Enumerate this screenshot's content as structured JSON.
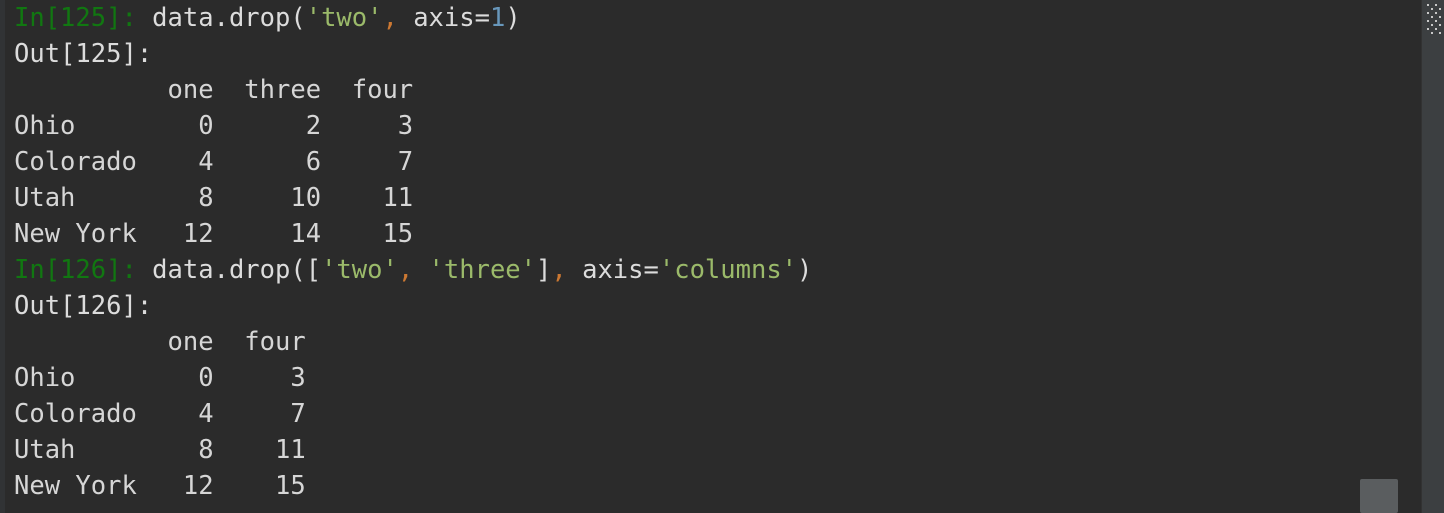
{
  "theme": {
    "background": "#2b2b2b",
    "gutter": "#313335",
    "text": "#dcdcdc",
    "prompt_green": "#117711",
    "string_green": "#9bba6a",
    "number_blue": "#6897bb",
    "comma_orange": "#cc7832",
    "scrollbar_track": "#3c3f41",
    "scrollbar_thumb": "#5a5d5f"
  },
  "console": {
    "title": "IPython console",
    "lines": [
      {
        "id": "in-125",
        "kind": "input",
        "prompt": "In[125]:",
        "code_plain": " data.drop(",
        "text": "In[125]: data.drop('two', axis=1)"
      },
      {
        "id": "out-125-label",
        "kind": "output-label",
        "text": "Out[125]:"
      },
      {
        "id": "out-125-header",
        "kind": "output",
        "text": "          one  three  four"
      },
      {
        "id": "out-125-row-ohio",
        "kind": "output",
        "text": "Ohio        0      2     3"
      },
      {
        "id": "out-125-row-colorado",
        "kind": "output",
        "text": "Colorado    4      6     7"
      },
      {
        "id": "out-125-row-utah",
        "kind": "output",
        "text": "Utah        8     10    11"
      },
      {
        "id": "out-125-row-newyork",
        "kind": "output",
        "text": "New York   12     14    15"
      },
      {
        "id": "in-126",
        "kind": "input",
        "prompt": "In[126]:",
        "text": "In[126]: data.drop(['two', 'three'], axis='columns')"
      },
      {
        "id": "out-126-label",
        "kind": "output-label",
        "text": "Out[126]:"
      },
      {
        "id": "out-126-header",
        "kind": "output",
        "text": "          one  four"
      },
      {
        "id": "out-126-row-ohio",
        "kind": "output",
        "text": "Ohio        0     3"
      },
      {
        "id": "out-126-row-colorado",
        "kind": "output",
        "text": "Colorado    4     7"
      },
      {
        "id": "out-126-row-utah",
        "kind": "output",
        "text": "Utah        8    11"
      },
      {
        "id": "out-126-row-newyork",
        "kind": "output",
        "text": "New York   12    15"
      }
    ]
  },
  "cell_125": {
    "prompt_in": "In[125]:",
    "prompt_out": "Out[125]:",
    "code_tokens": [
      {
        "t": "plain",
        "v": " data.drop("
      },
      {
        "t": "string",
        "v": "'two'"
      },
      {
        "t": "comma",
        "v": ","
      },
      {
        "t": "plain",
        "v": " axis="
      },
      {
        "t": "number",
        "v": "1"
      },
      {
        "t": "plain",
        "v": ")"
      }
    ],
    "table": {
      "index_name": "",
      "columns": [
        "one",
        "three",
        "four"
      ],
      "index": [
        "Ohio",
        "Colorado",
        "Utah",
        "New York"
      ],
      "rows": [
        [
          "0",
          "2",
          "3"
        ],
        [
          "4",
          "6",
          "7"
        ],
        [
          "8",
          "10",
          "11"
        ],
        [
          "12",
          "14",
          "15"
        ]
      ]
    }
  },
  "cell_126": {
    "prompt_in": "In[126]:",
    "prompt_out": "Out[126]:",
    "code_tokens": [
      {
        "t": "plain",
        "v": " data.drop(["
      },
      {
        "t": "string",
        "v": "'two'"
      },
      {
        "t": "comma",
        "v": ","
      },
      {
        "t": "plain",
        "v": " "
      },
      {
        "t": "string",
        "v": "'three'"
      },
      {
        "t": "plain",
        "v": "]"
      },
      {
        "t": "comma",
        "v": ","
      },
      {
        "t": "plain",
        "v": " axis="
      },
      {
        "t": "string",
        "v": "'columns'"
      },
      {
        "t": "plain",
        "v": ")"
      }
    ],
    "table": {
      "index_name": "",
      "columns": [
        "one",
        "four"
      ],
      "index": [
        "Ohio",
        "Colorado",
        "Utah",
        "New York"
      ],
      "rows": [
        [
          "0",
          "3"
        ],
        [
          "4",
          "7"
        ],
        [
          "8",
          "11"
        ],
        [
          "12",
          "15"
        ]
      ]
    }
  },
  "scrollbars": {
    "vertical_present": true,
    "horizontal_present": true,
    "grip_icon": "resize-grip-dots"
  }
}
